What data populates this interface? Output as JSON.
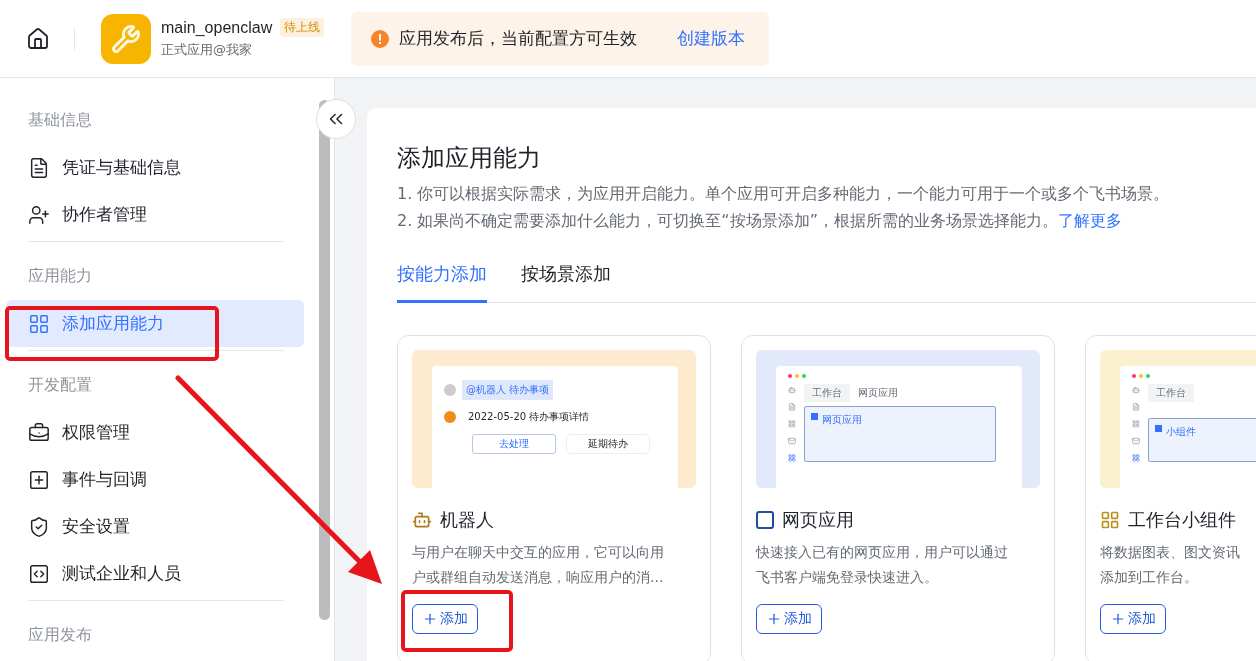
{
  "header": {
    "app_name": "main_openclaw",
    "status_badge": "待上线",
    "app_subtitle": "正式应用@我家",
    "notice": {
      "text": "应用发布后，当前配置方可生效",
      "link": "创建版本"
    }
  },
  "sidebar": {
    "groups": [
      {
        "title": "基础信息",
        "items": [
          {
            "label": "凭证与基础信息",
            "selected": false
          },
          {
            "label": "协作者管理",
            "selected": false
          }
        ]
      },
      {
        "title": "应用能力",
        "items": [
          {
            "label": "添加应用能力",
            "selected": true
          }
        ]
      },
      {
        "title": "开发配置",
        "items": [
          {
            "label": "权限管理",
            "selected": false
          },
          {
            "label": "事件与回调",
            "selected": false
          },
          {
            "label": "安全设置",
            "selected": false
          },
          {
            "label": "测试企业和人员",
            "selected": false
          }
        ]
      },
      {
        "title": "应用发布"
      }
    ]
  },
  "main": {
    "title": "添加应用能力",
    "notes": [
      {
        "text": "1. 你可以根据实际需求，为应用开启能力。单个应用可开启多种能力，一个能力可用于一个或多个飞书场景。"
      },
      {
        "text": "2. 如果尚不确定需要添加什么能力，可切换至“按场景添加”，根据所需的业务场景选择能力。",
        "link": "了解更多"
      }
    ],
    "tabs": [
      {
        "label": "按能力添加",
        "selected": true
      },
      {
        "label": "按场景添加",
        "selected": false
      }
    ],
    "cards": [
      {
        "kind": "robot",
        "title": "机器人",
        "description": [
          "与用户在聊天中交互的应用，它可以向用",
          "户或群组自动发送消息，响应用户的消..."
        ],
        "button": "添加",
        "preview": {
          "mention": "@机器人",
          "topic": "待办事项",
          "message": "2022-05-20 待办事项详情",
          "actions": [
            "去处理",
            "延期待办"
          ]
        }
      },
      {
        "kind": "web",
        "title": "网页应用",
        "description": [
          "快速接入已有的网页应用，用户可以通过",
          "飞书客户端免登录快速进入。"
        ],
        "button": "添加",
        "preview": {
          "tabs": [
            "工作台",
            "网页应用"
          ],
          "panel": "网页应用"
        }
      },
      {
        "kind": "widget",
        "title": "工作台小组件",
        "description": [
          "将数据图表、图文资讯",
          "添加到工作台。"
        ],
        "button": "添加",
        "preview": {
          "tabs": [
            "工作台"
          ],
          "panel": "小组件"
        }
      }
    ]
  }
}
